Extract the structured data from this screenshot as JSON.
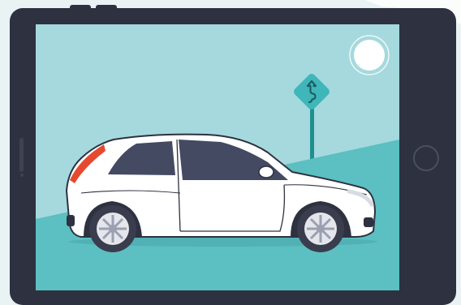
{
  "scene": {
    "subject": "car",
    "road_sign_symbol": "winding-road-sign",
    "colors": {
      "background": "#e9f3f3",
      "tablet_frame": "#2e3140",
      "screen_sky": "#a5d9dd",
      "hill": "#5cbfc2",
      "sign": "#3fb6ba",
      "sign_post": "#1f8f8e",
      "sun": "#ffffff",
      "car_body": "#ffffff",
      "car_windows": "#444a62",
      "tail_light": "#e5492f",
      "tires": "#3a3d4d"
    }
  }
}
